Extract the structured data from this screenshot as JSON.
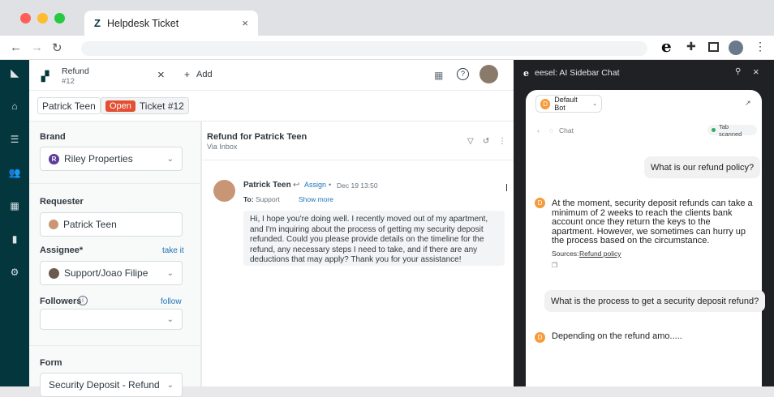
{
  "browser": {
    "tab_title": "Helpdesk Ticket",
    "ext_letter": "e"
  },
  "ticket_header": {
    "title": "Refund",
    "number": "#12",
    "add_label": "Add"
  },
  "breadcrumb": {
    "requester": "Patrick Teen",
    "status": "Open",
    "ticket": "Ticket #12"
  },
  "properties": {
    "brand_label": "Brand",
    "brand_value": "Riley Properties",
    "brand_initial": "R",
    "requester_label": "Requester",
    "requester_value": "Patrick Teen",
    "assignee_label": "Assignee*",
    "assignee_link": "take it",
    "assignee_value": "Support/Joao Filipe",
    "followers_label": "Followers",
    "followers_link": "follow",
    "form_label": "Form",
    "form_value": "Security Deposit - Refund"
  },
  "conversation": {
    "subject": "Refund for Patrick Teen",
    "via": "Via Inbox",
    "author": "Patrick Teen",
    "assign_link": "Assign",
    "date": "Dec 19 13:50",
    "to_label": "To:",
    "to_value": "Support",
    "show_more": "Show more",
    "message": "Hi, I hope you're doing well. I recently moved out of my apartment, and I'm inquiring about the process of getting my security deposit refunded. Could you please provide details on the timeline for the refund, any necessary steps I need to take, and if there are any deductions that may apply? Thank you for your assistance!"
  },
  "sidebar": {
    "title": "eesel: AI Sidebar Chat",
    "bot_name": "Default Bot",
    "bot_initial": "D",
    "chat_label": "Chat",
    "scanned_badge": "Tab scanned",
    "user_q1": "What is our refund policy?",
    "bot_a1": "At the moment, security deposit refunds can take a minimum of 2 weeks to reach the clients bank account once they return the keys to the apartment. However, we sometimes can hurry up the process based on the circumstance.",
    "sources_label": "Sources:",
    "sources_link": "Refund policy",
    "user_q2": "What is the process to get a security deposit refund?",
    "bot_a2": "Depending on the refund amo....."
  },
  "colors": {
    "zendesk_nav": "#03363d",
    "open_badge": "#e34f32",
    "link": "#1f73b7",
    "bot_avatar": "#f59b3a",
    "sidebar_bg": "#1f2124"
  }
}
